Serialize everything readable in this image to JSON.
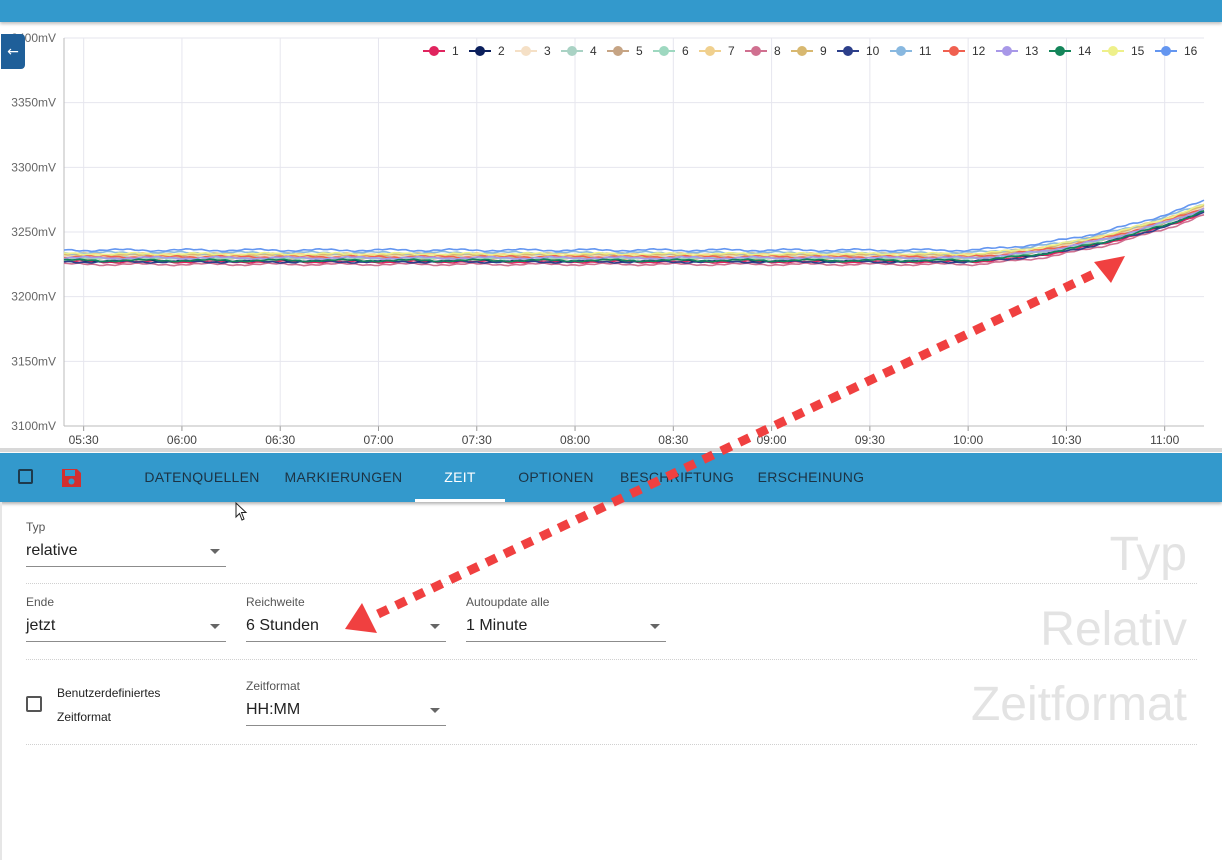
{
  "chart_data": {
    "type": "line",
    "y_ticks": [
      "3400mV",
      "3350mV",
      "3300mV",
      "3250mV",
      "3200mV",
      "3150mV",
      "3100mV"
    ],
    "x_ticks": [
      "05:30",
      "06:00",
      "06:30",
      "07:00",
      "07:30",
      "08:00",
      "08:30",
      "09:00",
      "09:30",
      "10:00",
      "10:30",
      "11:00"
    ],
    "ylim": [
      3100,
      3400
    ],
    "x_range_hours": [
      5.4,
      11.2
    ],
    "grid": true,
    "legend_position": "top-right",
    "series": [
      {
        "name": "1",
        "color": "#e0245e",
        "base": 3227
      },
      {
        "name": "2",
        "color": "#0b1f5c",
        "base": 3228
      },
      {
        "name": "3",
        "color": "#f5e0c6",
        "base": 3231
      },
      {
        "name": "4",
        "color": "#a9d2c4",
        "base": 3230
      },
      {
        "name": "5",
        "color": "#c6a484",
        "base": 3229
      },
      {
        "name": "6",
        "color": "#9ed8c0",
        "base": 3229
      },
      {
        "name": "7",
        "color": "#f0d08e",
        "base": 3233
      },
      {
        "name": "8",
        "color": "#d07090",
        "base": 3225
      },
      {
        "name": "9",
        "color": "#d8b870",
        "base": 3232
      },
      {
        "name": "10",
        "color": "#2c3f8a",
        "base": 3227
      },
      {
        "name": "11",
        "color": "#88b8e0",
        "base": 3234
      },
      {
        "name": "12",
        "color": "#f06050",
        "base": 3231
      },
      {
        "name": "13",
        "color": "#a898e8",
        "base": 3230
      },
      {
        "name": "14",
        "color": "#14855a",
        "base": 3228
      },
      {
        "name": "15",
        "color": "#eef08a",
        "base": 3233
      },
      {
        "name": "16",
        "color": "#6496f0",
        "base": 3236
      }
    ]
  },
  "toolbar": {
    "tabs": [
      {
        "label": "DATENQUELLEN"
      },
      {
        "label": "MARKIERUNGEN"
      },
      {
        "label": "ZEIT"
      },
      {
        "label": "OPTIONEN"
      },
      {
        "label": "BESCHRIFTUNG"
      },
      {
        "label": "ERSCHEINUNG"
      }
    ],
    "save_color": "#d32f2f"
  },
  "form": {
    "typ": {
      "label": "Typ",
      "value": "relative"
    },
    "ende": {
      "label": "Ende",
      "value": "jetzt"
    },
    "reichweite": {
      "label": "Reichweite",
      "value": "6 Stunden"
    },
    "autoupdate": {
      "label": "Autoupdate alle",
      "value": "1 Minute"
    },
    "custom_format": {
      "label_line1": "Benutzerdefiniertes",
      "label_line2": "Zeitformat"
    },
    "zeitformat": {
      "label": "Zeitformat",
      "value": "HH:MM"
    }
  },
  "section_headers": [
    "Typ",
    "Relativ",
    "Zeitformat"
  ]
}
